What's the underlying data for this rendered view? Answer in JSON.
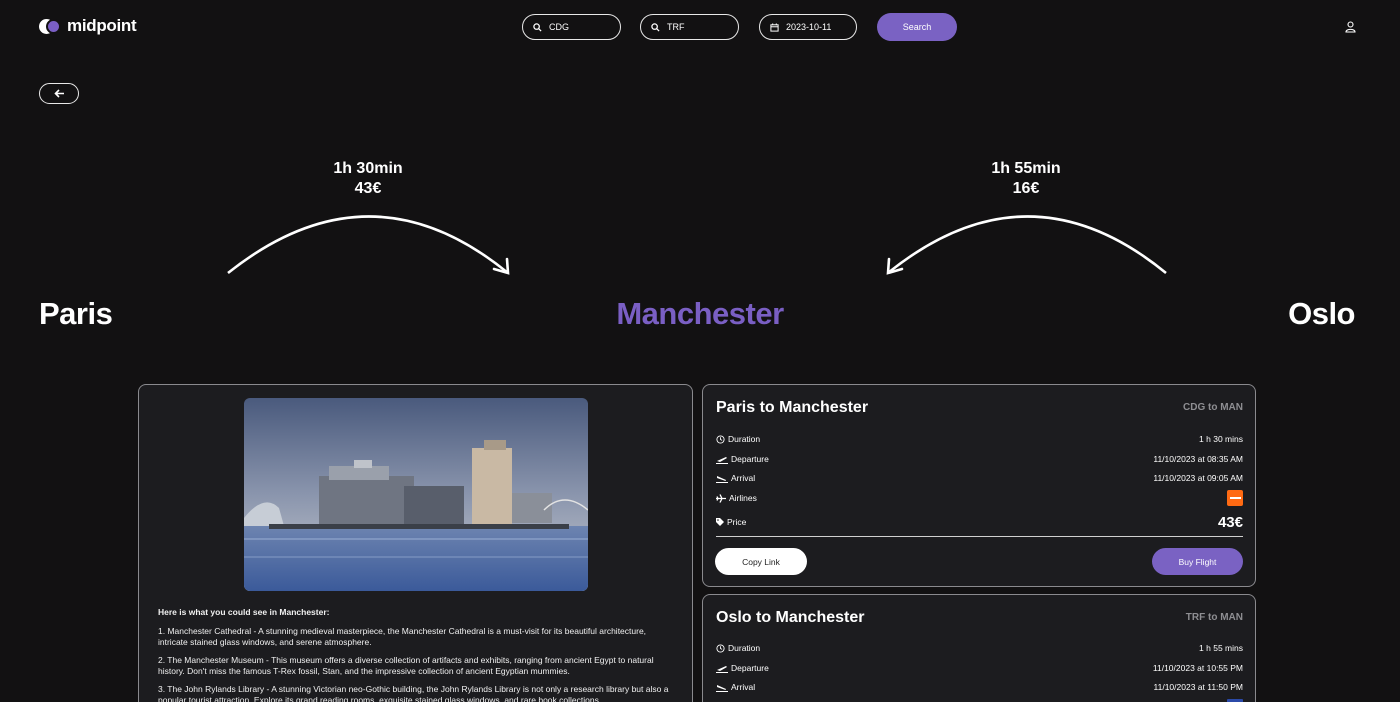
{
  "brand": {
    "name": "midpoint"
  },
  "search": {
    "origin": "CDG",
    "destination": "TRF",
    "date": "2023-10-11",
    "button_label": "Search"
  },
  "route": {
    "origin_city": "Paris",
    "midpoint_city": "Manchester",
    "destination_city": "Oslo",
    "leg1": {
      "duration": "1h 30min",
      "price": "43€"
    },
    "leg2": {
      "duration": "1h 55min",
      "price": "16€"
    }
  },
  "info": {
    "heading": "Here is what you could see in Manchester:",
    "items": [
      "1. Manchester Cathedral - A stunning medieval masterpiece, the Manchester Cathedral is a must-visit for its beautiful architecture, intricate stained glass windows, and serene atmosphere.",
      "2. The Manchester Museum - This museum offers a diverse collection of artifacts and exhibits, ranging from ancient Egypt to natural history. Don't miss the famous T-Rex fossil, Stan, and the impressive collection of ancient Egyptian mummies.",
      "3. The John Rylands Library - A stunning Victorian neo-Gothic building, the John Rylands Library is not only a research library but also a popular tourist attraction. Explore its grand reading rooms, exquisite stained glass windows, and rare book collections."
    ]
  },
  "flights": [
    {
      "title": "Paris to Manchester",
      "code": "CDG to MAN",
      "labels": {
        "duration": "Duration",
        "departure": "Departure",
        "arrival": "Arrival",
        "airlines": "Airlines",
        "price": "Price"
      },
      "duration": "1 h 30 mins",
      "departure": "11/10/2023 at 08:35 AM",
      "arrival": "11/10/2023 at 09:05 AM",
      "price": "43€",
      "copy_label": "Copy Link",
      "buy_label": "Buy Flight",
      "airline_color": "#ff6a13"
    },
    {
      "title": "Oslo to Manchester",
      "code": "TRF to MAN",
      "labels": {
        "duration": "Duration",
        "departure": "Departure",
        "arrival": "Arrival"
      },
      "duration": "1 h 55 mins",
      "departure": "11/10/2023 at 10:55 PM",
      "arrival": "11/10/2023 at 11:50 PM",
      "airline_color": "#2b4aa8"
    }
  ],
  "colors": {
    "accent": "#7a62c3",
    "background": "#121112",
    "card": "#1c1c1f"
  }
}
